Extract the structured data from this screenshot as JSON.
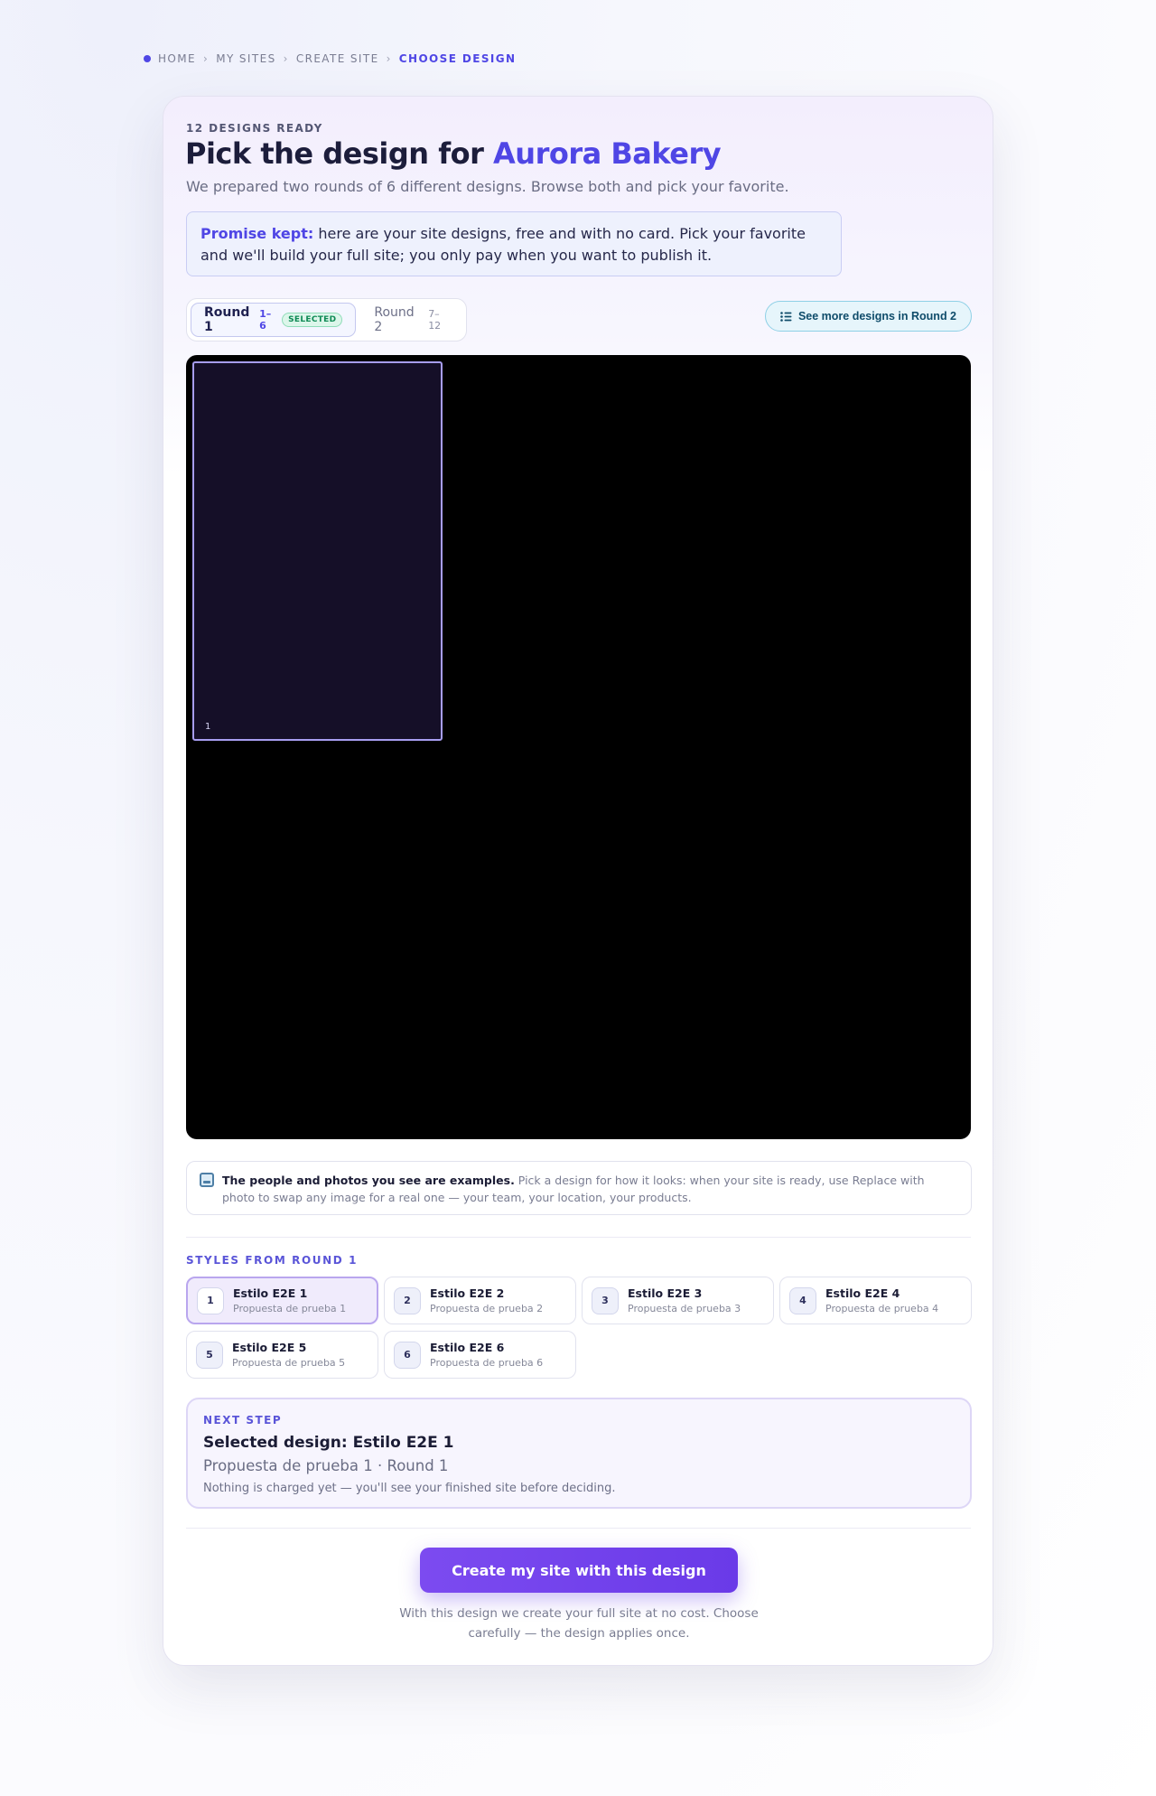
{
  "breadcrumb": {
    "items": [
      "HOME",
      "MY SITES",
      "CREATE SITE"
    ],
    "current": "CHOOSE DESIGN"
  },
  "header": {
    "eyebrow": "12 DESIGNS READY",
    "title_prefix": "Pick the design for ",
    "business_name": "Aurora Bakery",
    "subtitle": "We prepared two rounds of 6 different designs. Browse both and pick your favorite."
  },
  "promise": {
    "lead": "Promise kept:",
    "text": " here are your site designs, free and with no card. Pick your favorite and we'll build your full site; you only pay when you want to publish it."
  },
  "tabs": [
    {
      "label": "Round 1",
      "range": "1–6",
      "badge": "SELECTED",
      "active": true
    },
    {
      "label": "Round 2",
      "range": "7–12",
      "active": false
    }
  ],
  "see_more_label": "See more designs in Round 2",
  "preview": {
    "number": "1"
  },
  "note": {
    "strong": "The people and photos you see are examples.",
    "text": " Pick a design for how it looks: when your site is ready, use Replace with photo to swap any image for a real one — your team, your location, your products."
  },
  "styles_label": "STYLES FROM ROUND 1",
  "styles": [
    {
      "num": "1",
      "name": "Estilo E2E 1",
      "sub": "Propuesta de prueba 1",
      "selected": true
    },
    {
      "num": "2",
      "name": "Estilo E2E 2",
      "sub": "Propuesta de prueba 2",
      "selected": false
    },
    {
      "num": "3",
      "name": "Estilo E2E 3",
      "sub": "Propuesta de prueba 3",
      "selected": false
    },
    {
      "num": "4",
      "name": "Estilo E2E 4",
      "sub": "Propuesta de prueba 4",
      "selected": false
    },
    {
      "num": "5",
      "name": "Estilo E2E 5",
      "sub": "Propuesta de prueba 5",
      "selected": false
    },
    {
      "num": "6",
      "name": "Estilo E2E 6",
      "sub": "Propuesta de prueba 6",
      "selected": false
    }
  ],
  "next_step": {
    "kicker": "NEXT STEP",
    "selected": "Selected design: Estilo E2E 1",
    "meta": "Propuesta de prueba 1 · Round 1",
    "fine": "Nothing is charged yet — you'll see your finished site before deciding."
  },
  "cta": {
    "label": "Create my site with this design",
    "note": "With this design we create your full site at no cost. Choose carefully — the design applies once."
  },
  "colors": {
    "accent": "#4f46e5",
    "cta": "#7c4bf0",
    "preview_bg": "#000000"
  },
  "icons": {
    "see_more": "list-icon",
    "note": "image-icon"
  }
}
